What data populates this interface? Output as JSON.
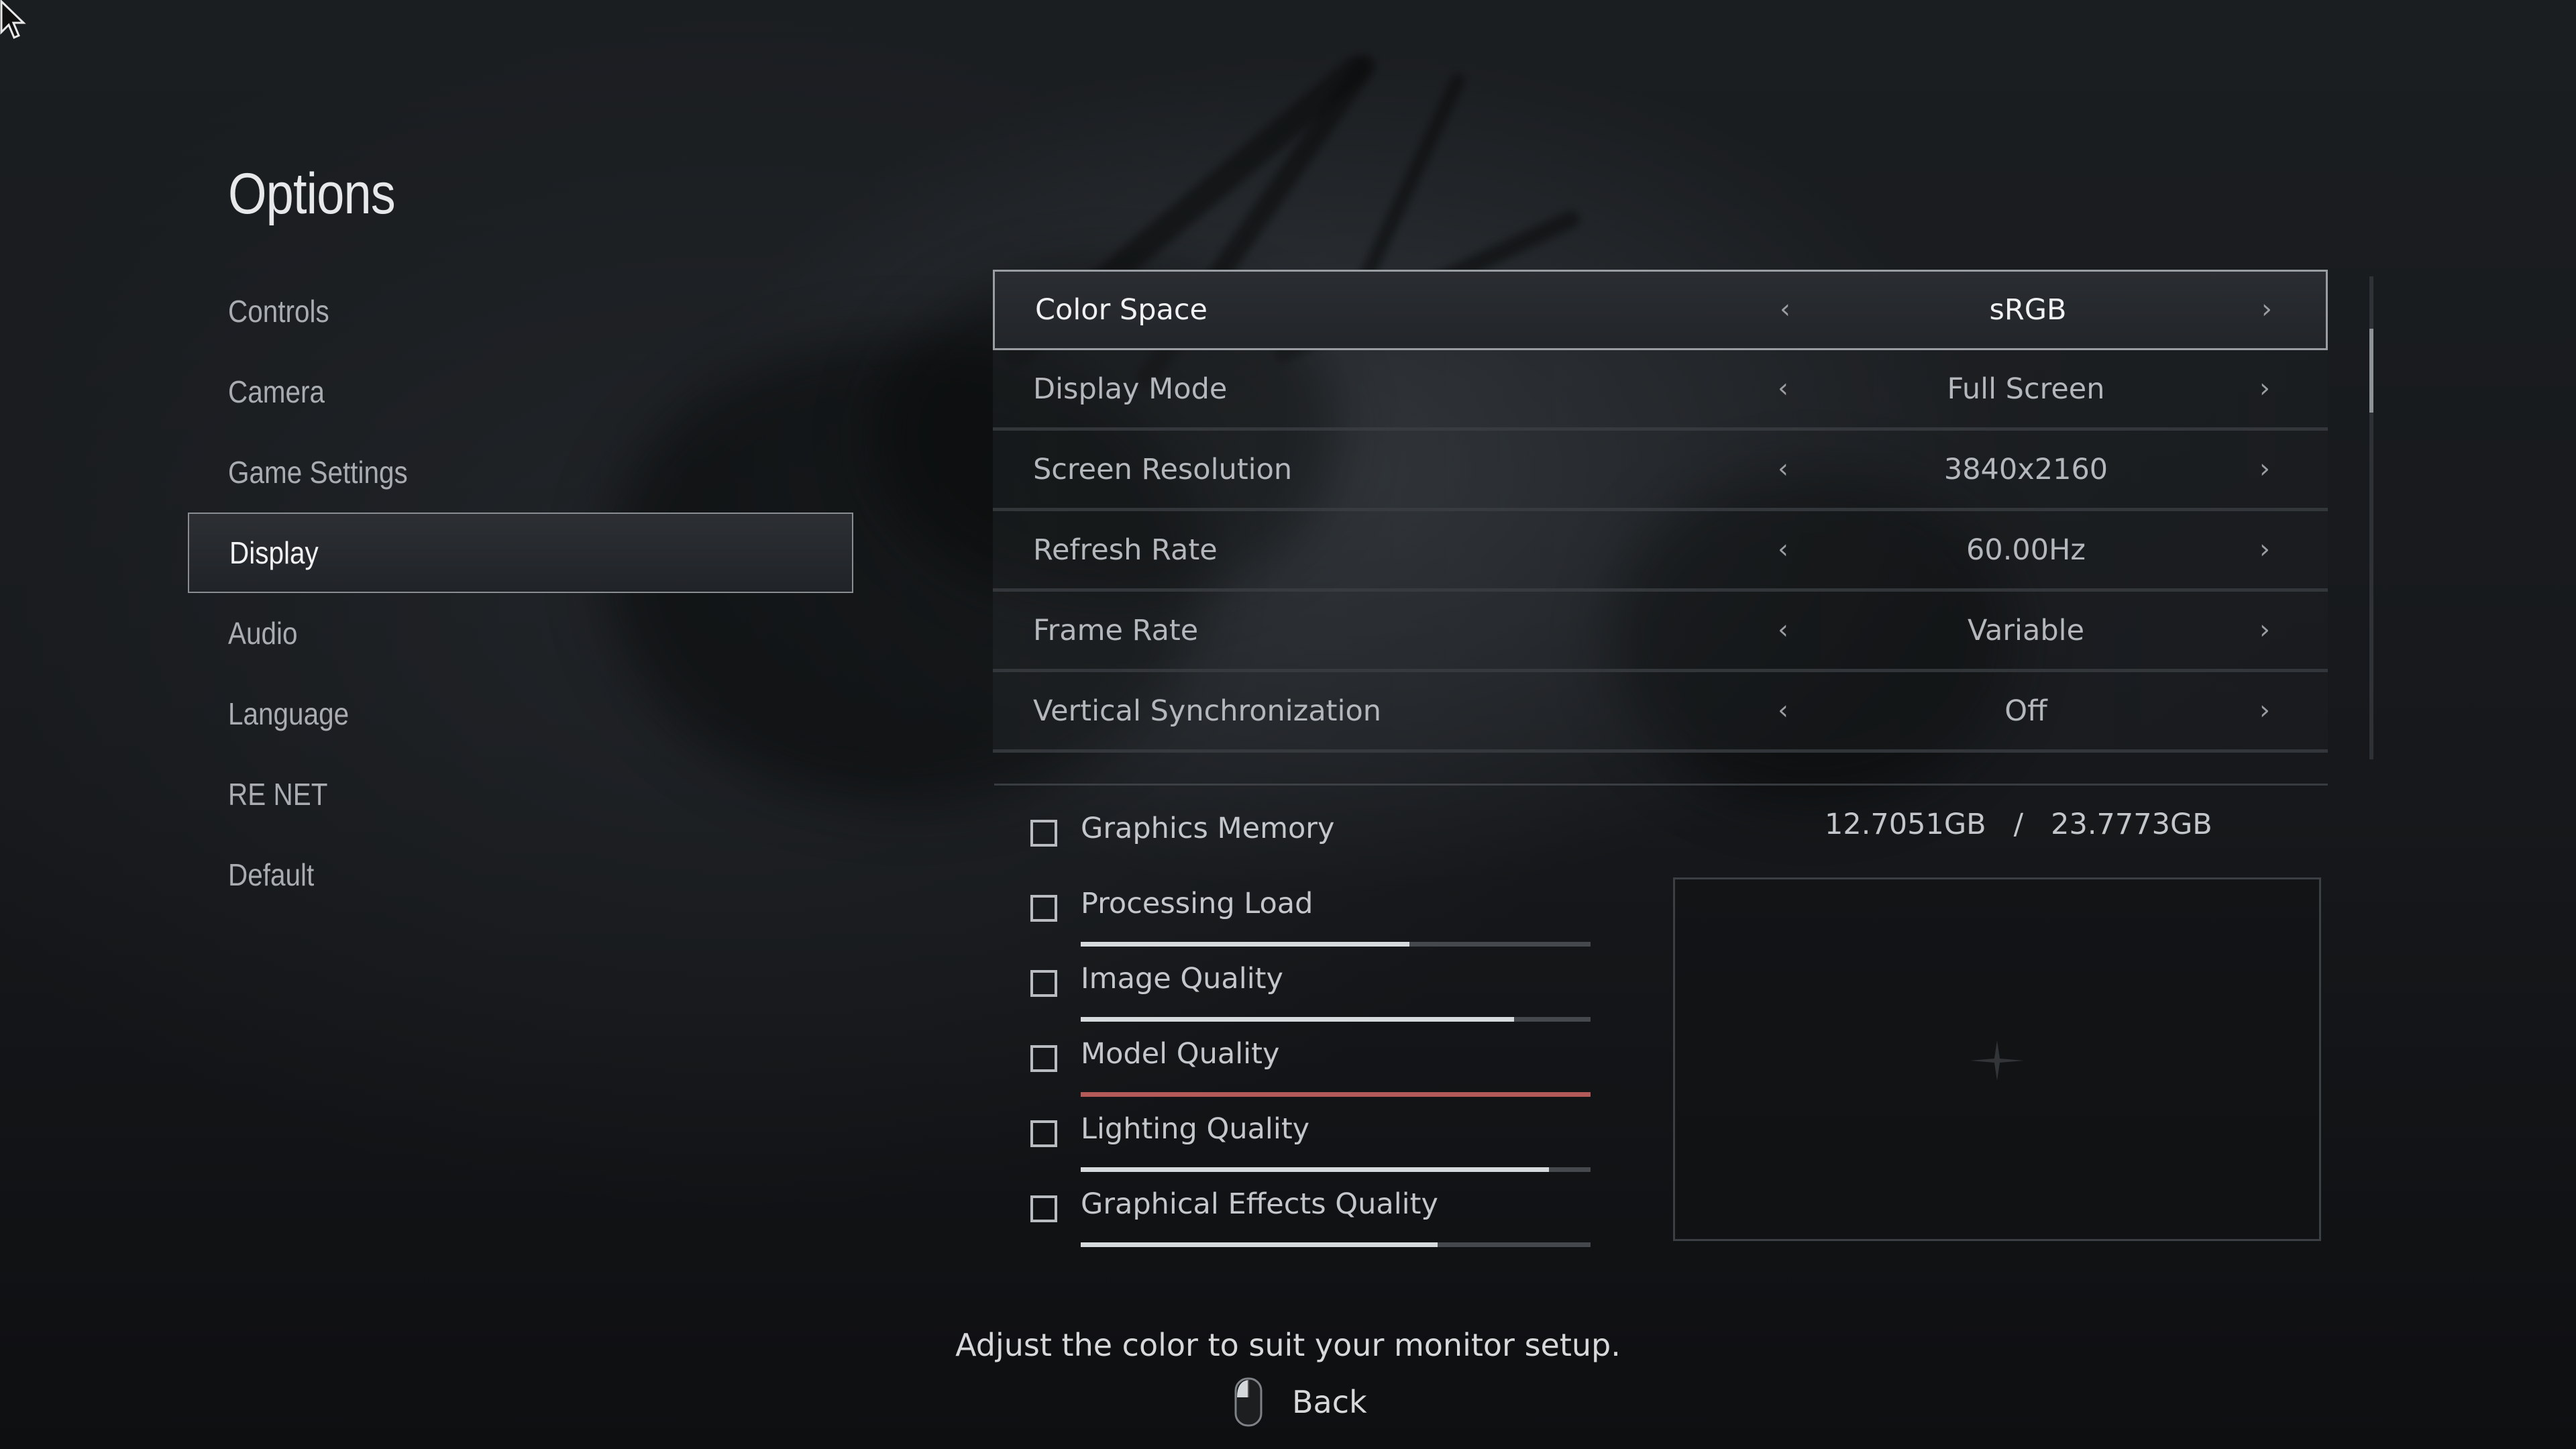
{
  "page_title": "Options",
  "menu": {
    "items": [
      {
        "label": "Controls",
        "active": false
      },
      {
        "label": "Camera",
        "active": false
      },
      {
        "label": "Game Settings",
        "active": false
      },
      {
        "label": "Display",
        "active": true
      },
      {
        "label": "Audio",
        "active": false
      },
      {
        "label": "Language",
        "active": false
      },
      {
        "label": "RE NET",
        "active": false
      },
      {
        "label": "Default",
        "active": false
      }
    ]
  },
  "settings": [
    {
      "name": "Color Space",
      "value": "sRGB",
      "selected": true
    },
    {
      "name": "Display Mode",
      "value": "Full Screen",
      "selected": false
    },
    {
      "name": "Screen Resolution",
      "value": "3840x2160",
      "selected": false
    },
    {
      "name": "Refresh Rate",
      "value": "60.00Hz",
      "selected": false
    },
    {
      "name": "Frame Rate",
      "value": "Variable",
      "selected": false
    },
    {
      "name": "Vertical Synchronization",
      "value": "Off",
      "selected": false
    }
  ],
  "graphics_memory": {
    "label": "Graphics Memory",
    "used": "12.7051GB",
    "separator": "/",
    "total": "23.7773GB"
  },
  "quality_meters": [
    {
      "label": "Processing Load",
      "level": 0.645,
      "warning": false
    },
    {
      "label": "Image Quality",
      "level": 0.85,
      "warning": false
    },
    {
      "label": "Model Quality",
      "level": 1.0,
      "warning": true
    },
    {
      "label": "Lighting Quality",
      "level": 0.918,
      "warning": false
    },
    {
      "label": "Graphical Effects Quality",
      "level": 0.7,
      "warning": false
    }
  ],
  "help_text": "Adjust the color to suit your monitor setup.",
  "footer": {
    "back_label": "Back",
    "back_icon": "mouse-icon"
  },
  "icons": {
    "left_arrow": "chevron-left-icon",
    "right_arrow": "chevron-right-icon"
  },
  "colors": {
    "warning_bar": "#b45a58",
    "bar_fill": "#d7dadc"
  }
}
